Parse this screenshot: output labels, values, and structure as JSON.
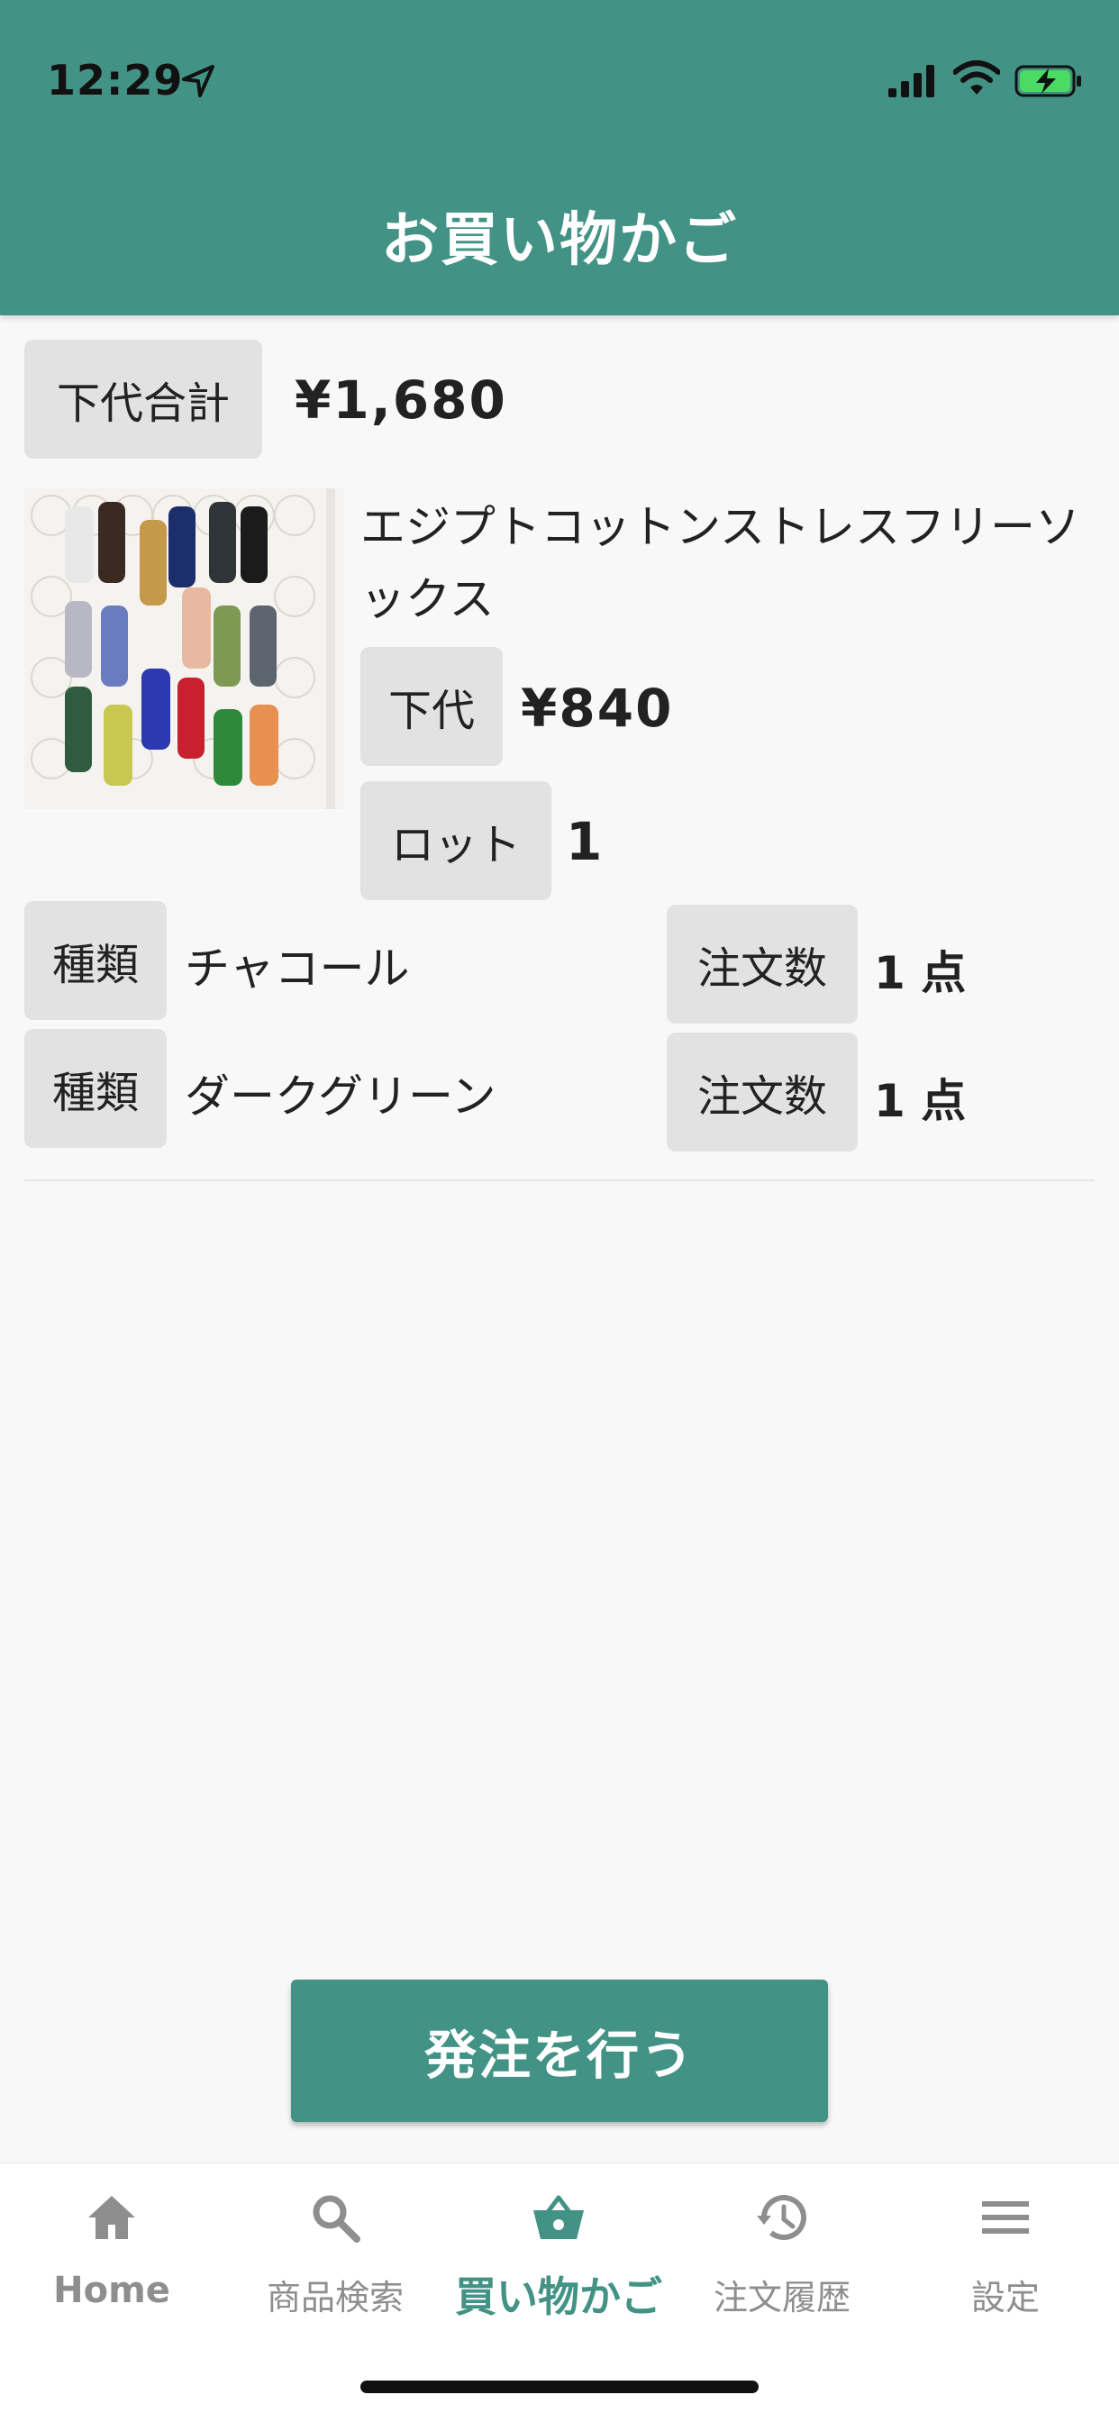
{
  "status_bar": {
    "time": "12:29"
  },
  "header": {
    "title": "お買い物かご"
  },
  "summary": {
    "label": "下代合計",
    "total": "¥1,680"
  },
  "product": {
    "name": "エジプトコットンストレスフリーソックス",
    "price_label": "下代",
    "price": "¥840",
    "lot_label": "ロット",
    "lot": "1"
  },
  "variants": [
    {
      "type_label": "種類",
      "type": "チャコール",
      "qty_label": "注文数",
      "qty": "1 点"
    },
    {
      "type_label": "種類",
      "type": "ダークグリーン",
      "qty_label": "注文数",
      "qty": "1 点"
    }
  ],
  "order_button": {
    "label": "発注を行う"
  },
  "tabs": [
    {
      "label": "Home",
      "icon": "home-icon",
      "active": false
    },
    {
      "label": "商品検索",
      "icon": "search-icon",
      "active": false
    },
    {
      "label": "買い物かご",
      "icon": "basket-icon",
      "active": true
    },
    {
      "label": "注文履歴",
      "icon": "history-icon",
      "active": false
    },
    {
      "label": "設定",
      "icon": "menu-icon",
      "active": false
    }
  ],
  "colors": {
    "primary": "#429385",
    "tag_bg": "#e2e2e2",
    "inactive": "#8e8e8e"
  }
}
